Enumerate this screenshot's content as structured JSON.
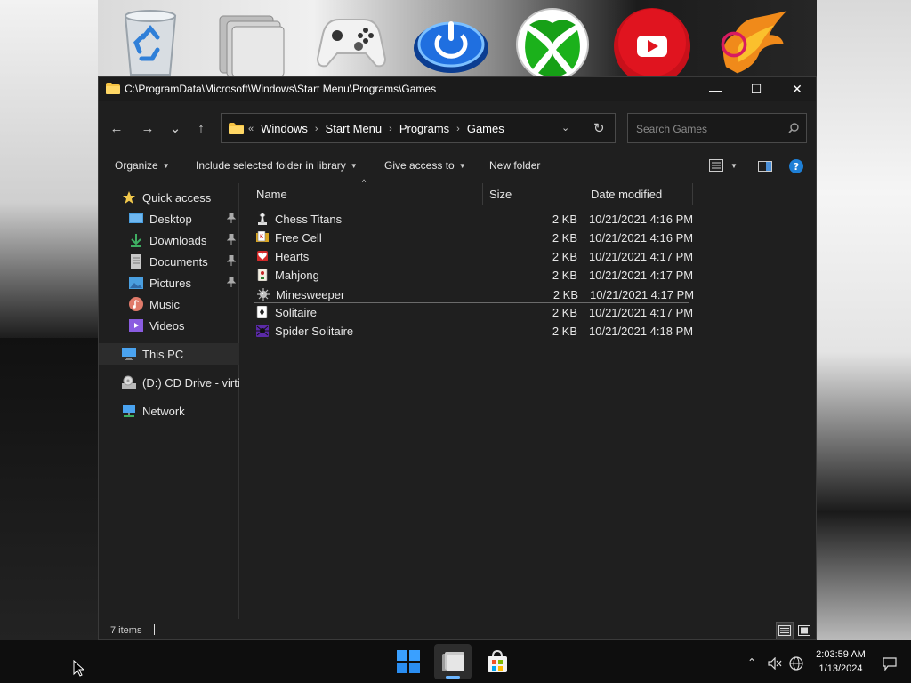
{
  "desktop": {
    "icons": [
      {
        "name": "Recycle Bin",
        "icon": "recycle-bin-icon"
      },
      {
        "name": "Extras",
        "icon": "folder-stack-icon"
      },
      {
        "name": "Games",
        "icon": "xbox-controller-icon"
      },
      {
        "name": "Power",
        "icon": "power-icon"
      },
      {
        "name": "Xbox",
        "icon": "xbox-icon"
      },
      {
        "name": "YouTube",
        "icon": "youtube-icon"
      },
      {
        "name": "Phoenix",
        "icon": "phoenix-icon"
      }
    ]
  },
  "window": {
    "title": "C:\\ProgramData\\Microsoft\\Windows\\Start Menu\\Programs\\Games",
    "controls": {
      "minimize": "—",
      "maximize": "☐",
      "close": "✕"
    }
  },
  "navigation": {
    "back": "←",
    "forward": "→",
    "recent": "⌄",
    "up": "↑"
  },
  "address": {
    "overflow": "«",
    "crumbs": [
      "Windows",
      "Start Menu",
      "Programs",
      "Games"
    ],
    "sep": "›",
    "dropdown": "⌄",
    "refresh": "↻"
  },
  "search": {
    "placeholder": "Search Games"
  },
  "commands": {
    "organize": "Organize",
    "include": "Include selected folder in library",
    "give_access": "Give access to",
    "new_folder": "New folder"
  },
  "sidebar": {
    "items": [
      {
        "label": "Quick access",
        "icon": "star-icon",
        "color": "#f2c94c"
      },
      {
        "label": "Desktop",
        "icon": "desktop-icon",
        "color": "#4a9fe0",
        "pinned": true
      },
      {
        "label": "Downloads",
        "icon": "download-icon",
        "color": "#3fae62",
        "pinned": true
      },
      {
        "label": "Documents",
        "icon": "documents-icon",
        "color": "#c8c8c8",
        "pinned": true
      },
      {
        "label": "Pictures",
        "icon": "pictures-icon",
        "color": "#4a9fe0",
        "pinned": true
      },
      {
        "label": "Music",
        "icon": "music-icon",
        "color": "#e07a6a"
      },
      {
        "label": "Videos",
        "icon": "videos-icon",
        "color": "#8a5ce0"
      },
      {
        "label": "This PC",
        "icon": "computer-icon",
        "color": "#4aa3f0"
      },
      {
        "label": "(D:) CD Drive - virtio-win",
        "icon": "cd-drive-icon",
        "color": "#b8b8b8"
      },
      {
        "label": "Network",
        "icon": "network-icon",
        "color": "#4aa3f0"
      }
    ]
  },
  "columns": {
    "name": "Name",
    "size": "Size",
    "date": "Date modified"
  },
  "files": [
    {
      "name": "Chess Titans",
      "size": "2 KB",
      "date": "10/21/2021 4:16 PM",
      "icon": "chess-icon"
    },
    {
      "name": "Free Cell",
      "size": "2 KB",
      "date": "10/21/2021 4:16 PM",
      "icon": "freecell-icon"
    },
    {
      "name": "Hearts",
      "size": "2 KB",
      "date": "10/21/2021 4:17 PM",
      "icon": "hearts-icon"
    },
    {
      "name": "Mahjong",
      "size": "2 KB",
      "date": "10/21/2021 4:17 PM",
      "icon": "mahjong-icon"
    },
    {
      "name": "Minesweeper",
      "size": "2 KB",
      "date": "10/21/2021 4:17 PM",
      "icon": "minesweeper-icon"
    },
    {
      "name": "Solitaire",
      "size": "2 KB",
      "date": "10/21/2021 4:17 PM",
      "icon": "solitaire-icon"
    },
    {
      "name": "Spider Solitaire",
      "size": "2 KB",
      "date": "10/21/2021 4:18 PM",
      "icon": "spider-solitaire-icon"
    }
  ],
  "status": {
    "count": "7 items"
  },
  "taskbar": {
    "apps": [
      {
        "name": "Start",
        "icon": "windows-logo-icon"
      },
      {
        "name": "File Explorer",
        "icon": "file-explorer-icon",
        "active": true
      },
      {
        "name": "Microsoft Store",
        "icon": "store-icon"
      }
    ],
    "tray": {
      "chevron": "⌃"
    },
    "clock": {
      "time": "2:03:59 AM",
      "date": "1/13/2024"
    }
  },
  "colors": {
    "accent": "#0a84d8",
    "window_bg": "#1f1f1f",
    "taskbar_bg": "#0e0e0e"
  }
}
